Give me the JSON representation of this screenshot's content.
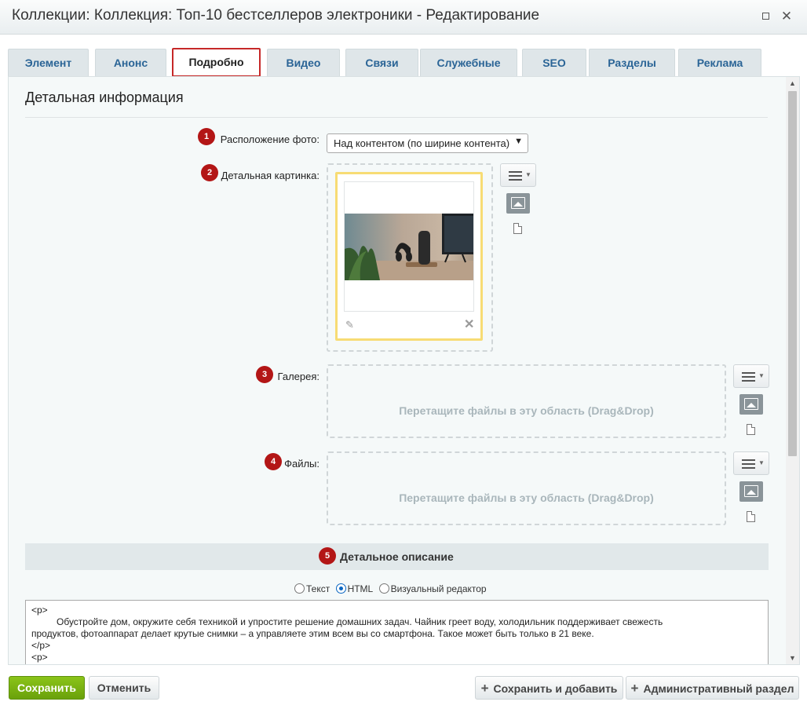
{
  "window": {
    "title": "Коллекции: Коллекция: Топ-10 бестселлеров электроники - Редактирование"
  },
  "tabs": [
    {
      "label": "Элемент"
    },
    {
      "label": "Анонс"
    },
    {
      "label": "Подробно"
    },
    {
      "label": "Видео"
    },
    {
      "label": "Связи"
    },
    {
      "label": "Служебные"
    },
    {
      "label": "SEO"
    },
    {
      "label": "Разделы"
    },
    {
      "label": "Реклама"
    }
  ],
  "active_tab": "Подробно",
  "section": {
    "title": "Детальная информация"
  },
  "fields": {
    "photo_position": {
      "badge": "1",
      "label": "Расположение фото:",
      "value": "Над контентом (по ширине контента)"
    },
    "detail_picture": {
      "badge": "2",
      "label": "Детальная картинка:"
    },
    "gallery": {
      "badge": "3",
      "label": "Галерея:",
      "dropzone": "Перетащите файлы в эту область (Drag&Drop)"
    },
    "files": {
      "badge": "4",
      "label": "Файлы:",
      "dropzone": "Перетащите файлы в эту область (Drag&Drop)"
    }
  },
  "description": {
    "badge": "5",
    "title": "Детальное описание",
    "modes": [
      {
        "label": "Текст",
        "selected": false
      },
      {
        "label": "HTML",
        "selected": true
      },
      {
        "label": "Визуальный редактор",
        "selected": false
      }
    ],
    "lines": [
      "<p>",
      "Обустройте дом, окружите себя техникой и упростите решение домашних задач. Чайник греет воду, холодильник поддерживает свежесть",
      "продуктов, фотоаппарат делает крутые снимки – а управляете этим всем вы со смартфона. Такое может быть только в 21 веке.",
      "</p>",
      "<p>"
    ]
  },
  "footer": {
    "save": "Сохранить",
    "cancel": "Отменить",
    "save_add": "Сохранить и добавить",
    "admin": "Административный раздел"
  },
  "colors": {
    "accent_green": "#7ab317",
    "badge_red": "#b31616",
    "active_tab_border": "#c62828",
    "image_highlight": "#f7dc74"
  }
}
